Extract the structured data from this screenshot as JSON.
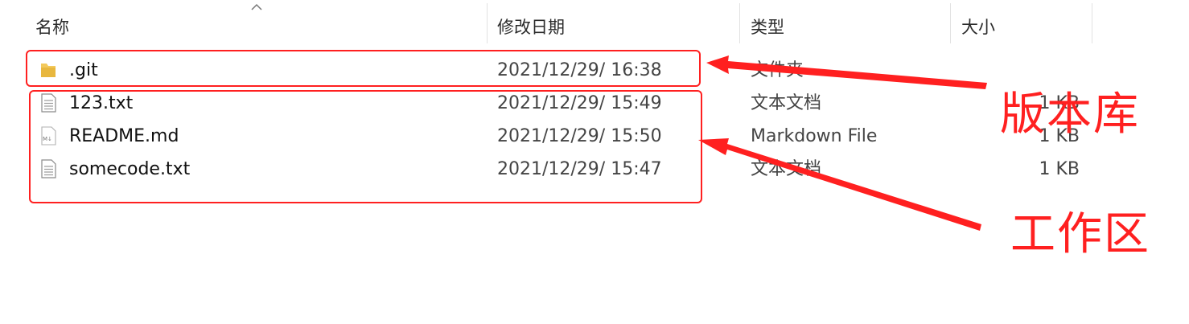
{
  "columns": {
    "name": "名称",
    "modified": "修改日期",
    "type": "类型",
    "size": "大小"
  },
  "rows": [
    {
      "name": ".git",
      "modified": "2021/12/29/ 16:38",
      "type": "文件夹",
      "size": "",
      "icon": "folder-icon"
    },
    {
      "name": "123.txt",
      "modified": "2021/12/29/ 15:49",
      "type": "文本文档",
      "size": "1 KB",
      "icon": "text-file-icon"
    },
    {
      "name": "README.md",
      "modified": "2021/12/29/ 15:50",
      "type": "Markdown File",
      "size": "1 KB",
      "icon": "markdown-file-icon"
    },
    {
      "name": "somecode.txt",
      "modified": "2021/12/29/ 15:47",
      "type": "文本文档",
      "size": "1 KB",
      "icon": "text-file-icon"
    }
  ],
  "annotations": {
    "repository_label": "版本库",
    "workspace_label": "工作区",
    "color": "#ff2020"
  },
  "colors": {
    "folder": "#f3c95c",
    "annotation": "#ff2020"
  }
}
